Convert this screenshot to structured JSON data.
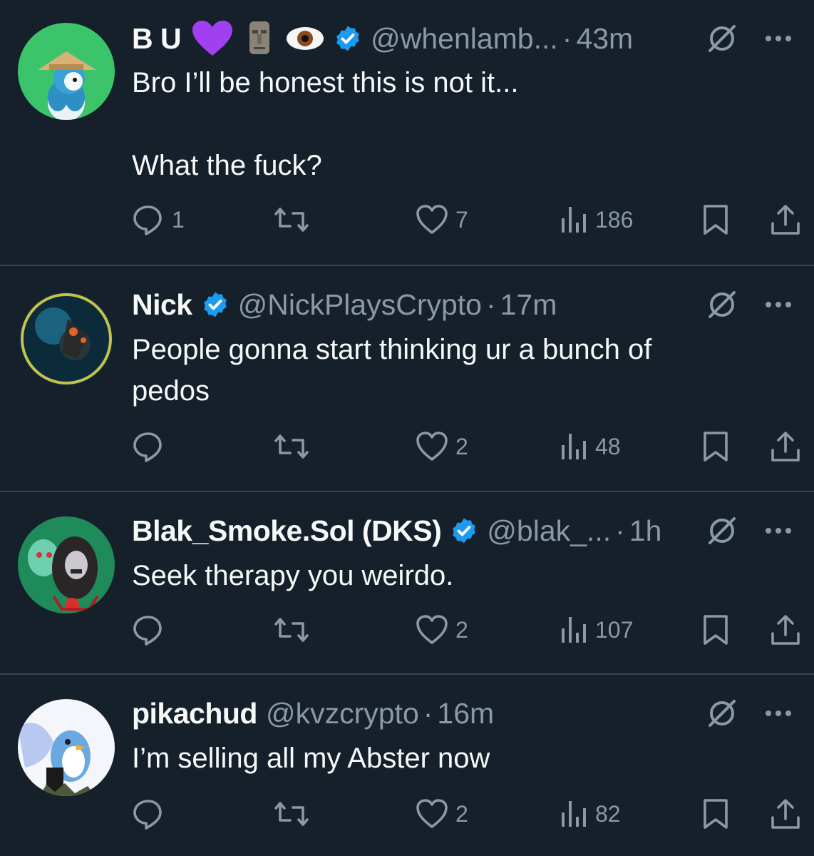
{
  "tweets": [
    {
      "name": "B U",
      "name_emojis": [
        "purple-heart",
        "moai",
        "eye"
      ],
      "handle": "@whenlamb...",
      "separator": "·",
      "time": "43m",
      "text": "Bro I’ll be honest this is not it...\n\nWhat the fuck?",
      "replies": "1",
      "reposts": "",
      "likes": "7",
      "views": "186"
    },
    {
      "name": "Nick",
      "handle": "@NickPlaysCrypto",
      "separator": "·",
      "time": "17m",
      "text": "People gonna start thinking ur a bunch of\npedos",
      "replies": "",
      "reposts": "",
      "likes": "2",
      "views": "48"
    },
    {
      "name": "Blak_Smoke.Sol (DKS)",
      "handle": "@blak_...",
      "separator": "·",
      "time": "1h",
      "text": "Seek therapy you weirdo.",
      "replies": "",
      "reposts": "",
      "likes": "2",
      "views": "107"
    },
    {
      "name": "pikachud",
      "handle": "@kvzcrypto",
      "separator": "·",
      "time": "16m",
      "text": "I’m selling all my Abster now",
      "replies": "",
      "reposts": "",
      "likes": "2",
      "views": "82"
    }
  ],
  "colors": {
    "background": "#15202b",
    "divider": "#38444d",
    "text": "#f7f9f9",
    "muted": "#8b98a5",
    "verified": "#1d9bf0"
  },
  "icons": [
    "verified-badge-icon",
    "grok-icon",
    "more-icon",
    "reply-icon",
    "repost-icon",
    "like-icon",
    "views-icon",
    "bookmark-icon",
    "share-icon"
  ]
}
